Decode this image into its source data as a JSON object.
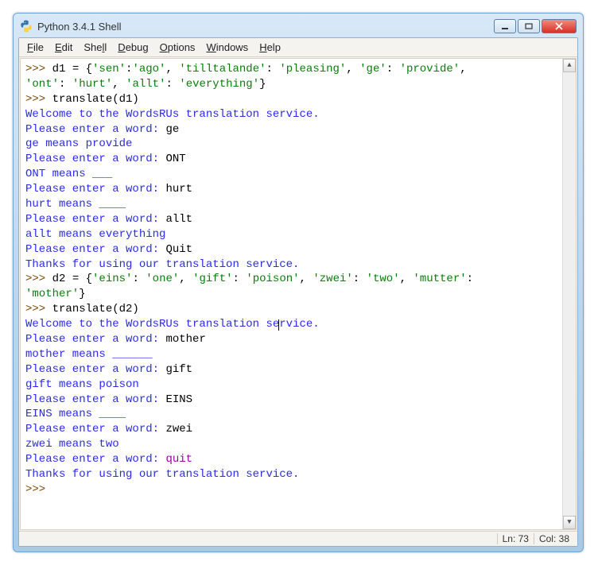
{
  "window": {
    "title": "Python 3.4.1 Shell"
  },
  "menu": {
    "file": "File",
    "edit": "Edit",
    "shell": "Shell",
    "debug": "Debug",
    "options": "Options",
    "windows": "Windows",
    "help": "Help"
  },
  "status": {
    "line": "Ln: 73",
    "col": "Col: 38"
  },
  "console": {
    "prompt": ">>> ",
    "session1": {
      "assign_var": "d1 = ",
      "dict_open": "{",
      "k1": "'sen'",
      "v1": "'ago'",
      "k2": "'tilltalande'",
      "v2": "'pleasing'",
      "k3": "'ge'",
      "v3": "'provide'",
      "k4": "'ont'",
      "v4": "'hurt'",
      "k5": "'allt'",
      "v5": "'everything'",
      "dict_close": "}",
      "call": "translate(d1)",
      "welcome": "Welcome to the WordsRUs translation service.",
      "p1_lbl": "Please enter a word: ",
      "p1_in": "ge",
      "r1": "ge means provide",
      "p2_lbl": "Please enter a word: ",
      "p2_in": "ONT",
      "r2": "ONT means ___",
      "p3_lbl": "Please enter a word: ",
      "p3_in": "hurt",
      "r3": "hurt means ____",
      "p4_lbl": "Please enter a word: ",
      "p4_in": "allt",
      "r4": "allt means everything",
      "p5_lbl": "Please enter a word: ",
      "p5_in": "Quit",
      "thanks": "Thanks for using our translation service."
    },
    "session2": {
      "assign_var": "d2 = ",
      "dict_open": "{",
      "k1": "'eins'",
      "v1": "'one'",
      "k2": "'gift'",
      "v2": "'poison'",
      "k3": "'zwei'",
      "v3": "'two'",
      "k4": "'mutter'",
      "v4": "'mother'",
      "dict_close": "}",
      "call": "translate(d2)",
      "welcome_a": "Welcome to the WordsRUs translation se",
      "welcome_b": "rvice.",
      "p1_lbl": "Please enter a word: ",
      "p1_in": "mother",
      "r1": "mother means ______",
      "p2_lbl": "Please enter a word: ",
      "p2_in": "gift",
      "r2": "gift means poison",
      "p3_lbl": "Please enter a word: ",
      "p3_in": "EINS",
      "r3": "EINS means ____",
      "p4_lbl": "Please enter a word: ",
      "p4_in": "zwei",
      "r4": "zwei means two",
      "p5_lbl": "Please enter a word: ",
      "p5_in": "quit",
      "thanks": "Thanks for using our translation service."
    },
    "final_prompt": ">>> "
  }
}
